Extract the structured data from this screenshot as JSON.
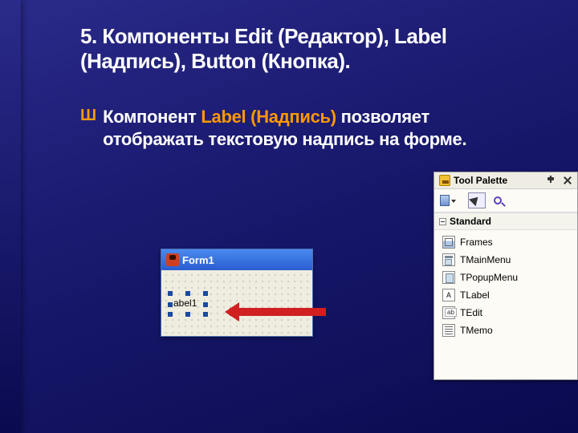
{
  "slide": {
    "title": "5. Компоненты Edit (Редактор), Label (Надпись), Button (Кнопка).",
    "bullet_glyph": "Ш",
    "body_pre": "Компонент ",
    "body_hl": "Label (Надпись)",
    "body_post": " позволяет отображать текстовую надпись на форме."
  },
  "form": {
    "title": "Form1",
    "label_text": "abel1"
  },
  "palette": {
    "title": "Tool Palette",
    "section": "Standard",
    "items": [
      {
        "label": "Frames",
        "icon": "frames"
      },
      {
        "label": "TMainMenu",
        "icon": "menu"
      },
      {
        "label": "TPopupMenu",
        "icon": "popup"
      },
      {
        "label": "TLabel",
        "icon": "label"
      },
      {
        "label": "TEdit",
        "icon": "edit"
      },
      {
        "label": "TMemo",
        "icon": "memo"
      }
    ]
  }
}
